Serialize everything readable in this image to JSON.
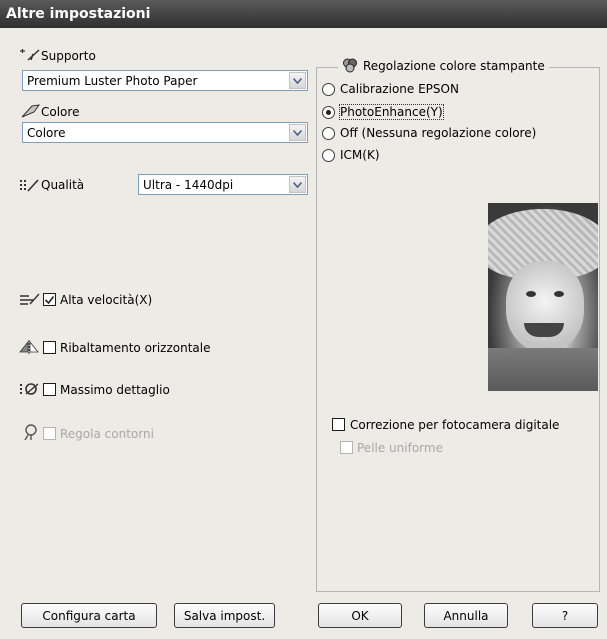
{
  "window": {
    "title": "Altre impostazioni"
  },
  "left": {
    "media_label": "Supporto",
    "media_value": "Premium Luster Photo Paper",
    "color_label": "Colore",
    "color_value": "Colore",
    "quality_label": "Qualità",
    "quality_value": "Ultra - 1440dpi",
    "high_speed_label": "Alta velocità(X)",
    "high_speed_checked": true,
    "flip_label": "Ribaltamento orizzontale",
    "flip_checked": false,
    "finest_detail_label": "Massimo dettaglio",
    "finest_detail_checked": false,
    "edge_smoothing_label": "Regola contorni",
    "edge_smoothing_checked": false,
    "edge_smoothing_disabled": true
  },
  "color_adjust": {
    "group_title": "Regolazione colore stampante",
    "options": [
      {
        "label": "Calibrazione EPSON",
        "selected": false
      },
      {
        "label": "PhotoEnhance(Y)",
        "selected": true
      },
      {
        "label": "Off (Nessuna regolazione colore)",
        "selected": false
      },
      {
        "label": "ICM(K)",
        "selected": false
      }
    ],
    "digital_camera_label": "Correzione per fotocamera digitale",
    "digital_camera_checked": false,
    "smooth_skin_label": "Pelle uniforme",
    "smooth_skin_checked": false,
    "smooth_skin_disabled": true
  },
  "buttons": {
    "paper_config": "Configura carta",
    "save_settings": "Salva impost.",
    "ok": "OK",
    "cancel": "Annulla",
    "help": "?"
  },
  "icons": {
    "media": "media-type-icon",
    "color": "color-icon",
    "quality": "quality-icon",
    "high_speed": "high-speed-icon",
    "flip": "flip-horizontal-icon",
    "finest": "finest-detail-icon",
    "edge": "edge-smoothing-icon",
    "color_adjust": "color-circles-icon"
  }
}
